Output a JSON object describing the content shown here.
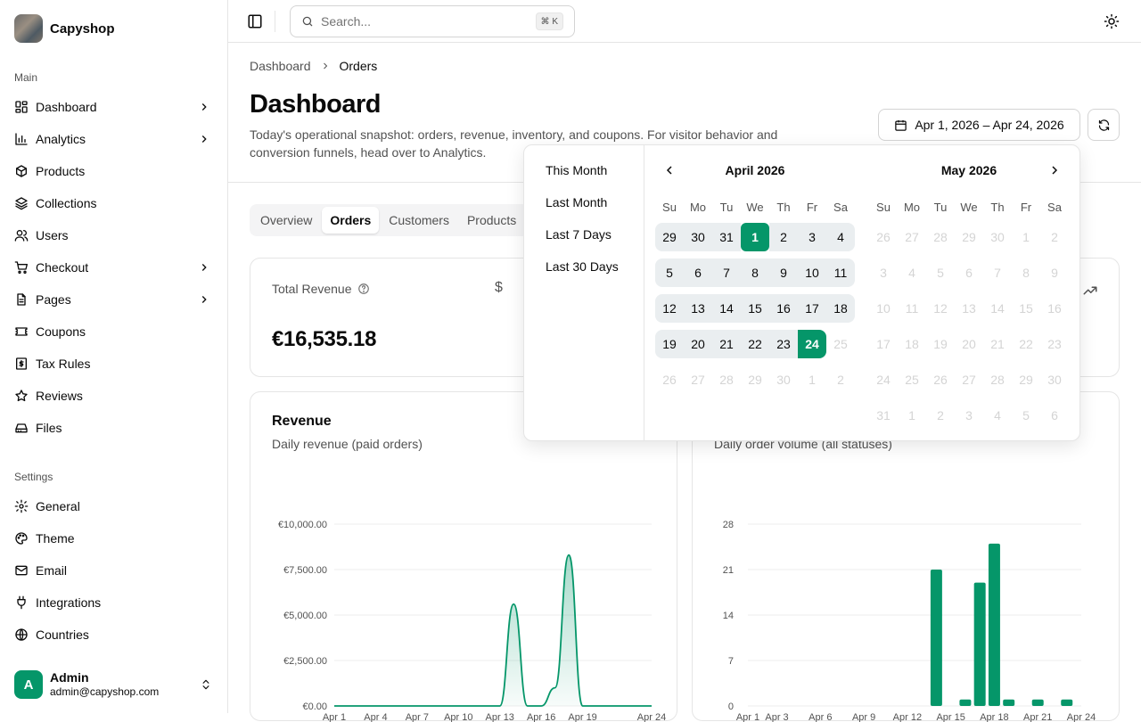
{
  "app": {
    "name": "Capyshop"
  },
  "sidebar": {
    "main_label": "Main",
    "settings_label": "Settings",
    "main_items": [
      {
        "label": "Dashboard",
        "icon": "dashboard-icon",
        "chevron": true
      },
      {
        "label": "Analytics",
        "icon": "bar-chart-icon",
        "chevron": true
      },
      {
        "label": "Products",
        "icon": "package-icon",
        "chevron": false
      },
      {
        "label": "Collections",
        "icon": "layers-icon",
        "chevron": false
      },
      {
        "label": "Users",
        "icon": "users-icon",
        "chevron": false
      },
      {
        "label": "Checkout",
        "icon": "cart-icon",
        "chevron": true
      },
      {
        "label": "Pages",
        "icon": "file-icon",
        "chevron": true
      },
      {
        "label": "Coupons",
        "icon": "ticket-icon",
        "chevron": false
      },
      {
        "label": "Tax Rules",
        "icon": "receipt-icon",
        "chevron": false
      },
      {
        "label": "Reviews",
        "icon": "star-icon",
        "chevron": false
      },
      {
        "label": "Files",
        "icon": "drive-icon",
        "chevron": false
      }
    ],
    "settings_items": [
      {
        "label": "General",
        "icon": "gear-icon"
      },
      {
        "label": "Theme",
        "icon": "palette-icon"
      },
      {
        "label": "Email",
        "icon": "mail-icon"
      },
      {
        "label": "Integrations",
        "icon": "plug-icon"
      },
      {
        "label": "Countries",
        "icon": "globe-icon"
      }
    ],
    "user": {
      "initial": "A",
      "name": "Admin",
      "email": "admin@capyshop.com"
    }
  },
  "topbar": {
    "search_placeholder": "Search...",
    "shortcut": "⌘ K"
  },
  "breadcrumb": {
    "parent": "Dashboard",
    "current": "Orders"
  },
  "page": {
    "title": "Dashboard",
    "description": "Today's operational snapshot: orders, revenue, inventory, and coupons. For visitor behavior and conversion funnels, head over to Analytics."
  },
  "date_range": {
    "label": "Apr 1, 2026 – Apr 24, 2026"
  },
  "tabs": [
    {
      "label": "Overview",
      "active": false
    },
    {
      "label": "Orders",
      "active": true
    },
    {
      "label": "Customers",
      "active": false
    },
    {
      "label": "Products",
      "active": false
    }
  ],
  "kpi": {
    "title": "Total Revenue",
    "value": "€16,535.18",
    "icon": "$"
  },
  "revenue_card": {
    "title": "Revenue",
    "subtitle": "Daily revenue (paid orders)"
  },
  "orders_card": {
    "subtitle": "Daily order volume (all statuses)"
  },
  "calendar": {
    "presets": [
      "This Month",
      "Last Month",
      "Last 7 Days",
      "Last 30 Days"
    ],
    "weekdays": [
      "Su",
      "Mo",
      "Tu",
      "We",
      "Th",
      "Fr",
      "Sa"
    ],
    "months": [
      {
        "title": "April 2026",
        "weeks": [
          [
            "29",
            "30",
            "31",
            "1",
            "2",
            "3",
            "4"
          ],
          [
            "5",
            "6",
            "7",
            "8",
            "9",
            "10",
            "11"
          ],
          [
            "12",
            "13",
            "14",
            "15",
            "16",
            "17",
            "18"
          ],
          [
            "19",
            "20",
            "21",
            "22",
            "23",
            "24",
            "25"
          ],
          [
            "26",
            "27",
            "28",
            "29",
            "30",
            "1",
            "2"
          ]
        ]
      },
      {
        "title": "May 2026",
        "weeks": [
          [
            "26",
            "27",
            "28",
            "29",
            "30",
            "1",
            "2"
          ],
          [
            "3",
            "4",
            "5",
            "6",
            "7",
            "8",
            "9"
          ],
          [
            "10",
            "11",
            "12",
            "13",
            "14",
            "15",
            "16"
          ],
          [
            "17",
            "18",
            "19",
            "20",
            "21",
            "22",
            "23"
          ],
          [
            "24",
            "25",
            "26",
            "27",
            "28",
            "29",
            "30"
          ],
          [
            "31",
            "1",
            "2",
            "3",
            "4",
            "5",
            "6"
          ]
        ]
      }
    ],
    "range_start": "2026-04-01",
    "range_end": "2026-04-24"
  },
  "chart_data": [
    {
      "type": "area",
      "title": "Revenue",
      "subtitle": "Daily revenue (paid orders)",
      "x": [
        "Apr 1",
        "Apr 2",
        "Apr 3",
        "Apr 4",
        "Apr 5",
        "Apr 6",
        "Apr 7",
        "Apr 8",
        "Apr 9",
        "Apr 10",
        "Apr 11",
        "Apr 12",
        "Apr 13",
        "Apr 14",
        "Apr 15",
        "Apr 16",
        "Apr 17",
        "Apr 18",
        "Apr 19",
        "Apr 20",
        "Apr 21",
        "Apr 22",
        "Apr 23",
        "Apr 24"
      ],
      "x_tick_labels": [
        "Apr 1",
        "Apr 4",
        "Apr 7",
        "Apr 10",
        "Apr 13",
        "Apr 16",
        "Apr 19",
        "Apr 24"
      ],
      "values": [
        0,
        0,
        0,
        0,
        0,
        0,
        0,
        0,
        0,
        0,
        0,
        0,
        0,
        5600,
        0,
        0,
        1000,
        8300,
        0,
        0,
        0,
        0,
        0,
        0
      ],
      "y_ticks": [
        "€0.00",
        "€2,500.00",
        "€5,000.00",
        "€7,500.00",
        "€10,000.00"
      ],
      "ylim": [
        0,
        10000
      ],
      "grid": true,
      "color": "#059669"
    },
    {
      "type": "bar",
      "subtitle": "Daily order volume (all statuses)",
      "x": [
        "Apr 1",
        "Apr 2",
        "Apr 3",
        "Apr 4",
        "Apr 5",
        "Apr 6",
        "Apr 7",
        "Apr 8",
        "Apr 9",
        "Apr 10",
        "Apr 11",
        "Apr 12",
        "Apr 13",
        "Apr 14",
        "Apr 15",
        "Apr 16",
        "Apr 17",
        "Apr 18",
        "Apr 19",
        "Apr 20",
        "Apr 21",
        "Apr 22",
        "Apr 23",
        "Apr 24"
      ],
      "x_tick_labels": [
        "Apr 1",
        "Apr 3",
        "Apr 6",
        "Apr 9",
        "Apr 12",
        "Apr 15",
        "Apr 18",
        "Apr 21",
        "Apr 24"
      ],
      "values": [
        0,
        0,
        0,
        0,
        0,
        0,
        0,
        0,
        0,
        0,
        0,
        0,
        0,
        21,
        0,
        1,
        19,
        25,
        1,
        0,
        1,
        0,
        1,
        0
      ],
      "y_ticks": [
        "0",
        "7",
        "14",
        "21",
        "28"
      ],
      "ylim": [
        0,
        28
      ],
      "grid": true,
      "color": "#059669"
    }
  ],
  "colors": {
    "accent": "#059669",
    "border": "#e5e5e5",
    "muted_text": "#525252"
  }
}
